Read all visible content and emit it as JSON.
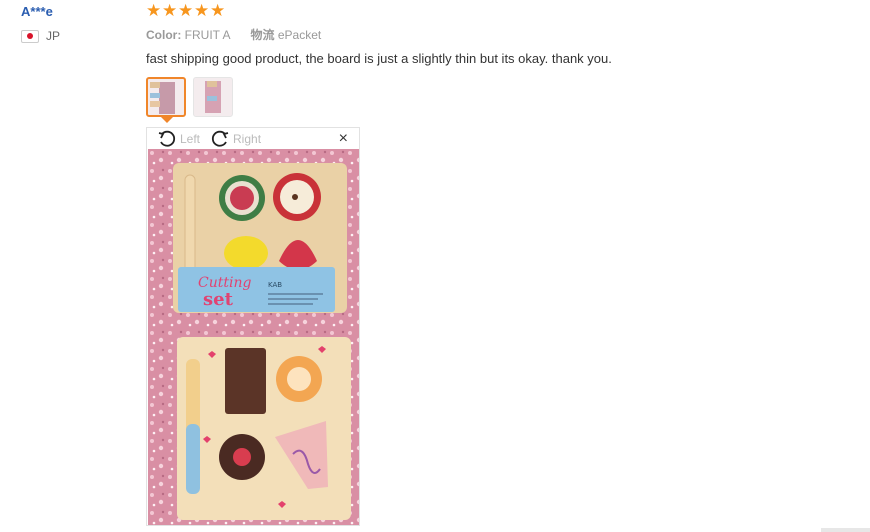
{
  "user": {
    "name": "A***e",
    "country": "JP"
  },
  "rating": {
    "stars": 5,
    "max": 5,
    "color": "#f7961e"
  },
  "sku": {
    "color_label": "Color:",
    "color_value": "FRUIT A",
    "shipping_label": "物流",
    "shipping_value": "ePacket"
  },
  "review": {
    "text": "fast shipping good product, the board is just a slightly thin but its okay. thank you."
  },
  "viewer": {
    "rotate_left_label": "Left",
    "rotate_right_label": "Right",
    "close_symbol": "×"
  },
  "photo": {
    "board_top_label_line1": "Cutting",
    "board_top_label_line2": "set",
    "brand": "KAB"
  }
}
